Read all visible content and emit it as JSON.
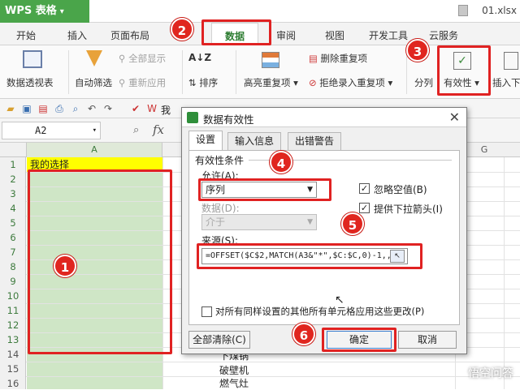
{
  "app": {
    "name": "WPS 表格",
    "file_name": "01.xlsx"
  },
  "ribbon_tabs": [
    "开始",
    "插入",
    "页面布局",
    "数据",
    "审阅",
    "视图",
    "开发工具",
    "云服务"
  ],
  "active_tab": "数据",
  "ribbon": {
    "pivot": "数据透视表",
    "autofilter": "自动筛选",
    "show_all": "全部显示",
    "reapply": "重新应用",
    "sort": "排序",
    "highlight_dup": "高亮重复项",
    "delete_dup": "删除重复项",
    "reject_dup": "拒绝录入重复项",
    "split": "分列",
    "validation": "有效性",
    "insert": "插入下"
  },
  "qat_extra": "我",
  "formula_bar": {
    "name_box": "A2",
    "fx": "fx"
  },
  "grid": {
    "col_a": "A",
    "col_g": "G",
    "rows": [
      "1",
      "2",
      "3",
      "4",
      "5",
      "6",
      "7",
      "8",
      "9",
      "10",
      "11",
      "12",
      "13",
      "14",
      "15",
      "16"
    ],
    "a1": "我的选择",
    "d_cells": [
      "下煤锅",
      "破壁机",
      "燃气灶"
    ]
  },
  "dialog": {
    "title": "数据有效性",
    "tabs": [
      "设置",
      "输入信息",
      "出错警告"
    ],
    "section": "有效性条件",
    "allow_label": "允许(A):",
    "allow_value": "序列",
    "data_label": "数据(D):",
    "data_value": "介于",
    "ignore_blank": "忽略空值(B)",
    "dropdown": "提供下拉箭头(I)",
    "source_label": "来源(S):",
    "source_value": "=OFFSET($C$2,MATCH(A3&\"*\",$C:$C,0)-1,,",
    "apply_all": "对所有同样设置的其他所有单元格应用这些更改(P)",
    "clear_all": "全部清除(C)",
    "ok": "确定",
    "cancel": "取消"
  },
  "badges": [
    "1",
    "2",
    "3",
    "4",
    "5",
    "6"
  ],
  "watermark": "悟空问答",
  "colors": {
    "accent_green": "#4aa54a",
    "callout_red": "#e02222",
    "selection_fill": "#cfe6c6"
  }
}
